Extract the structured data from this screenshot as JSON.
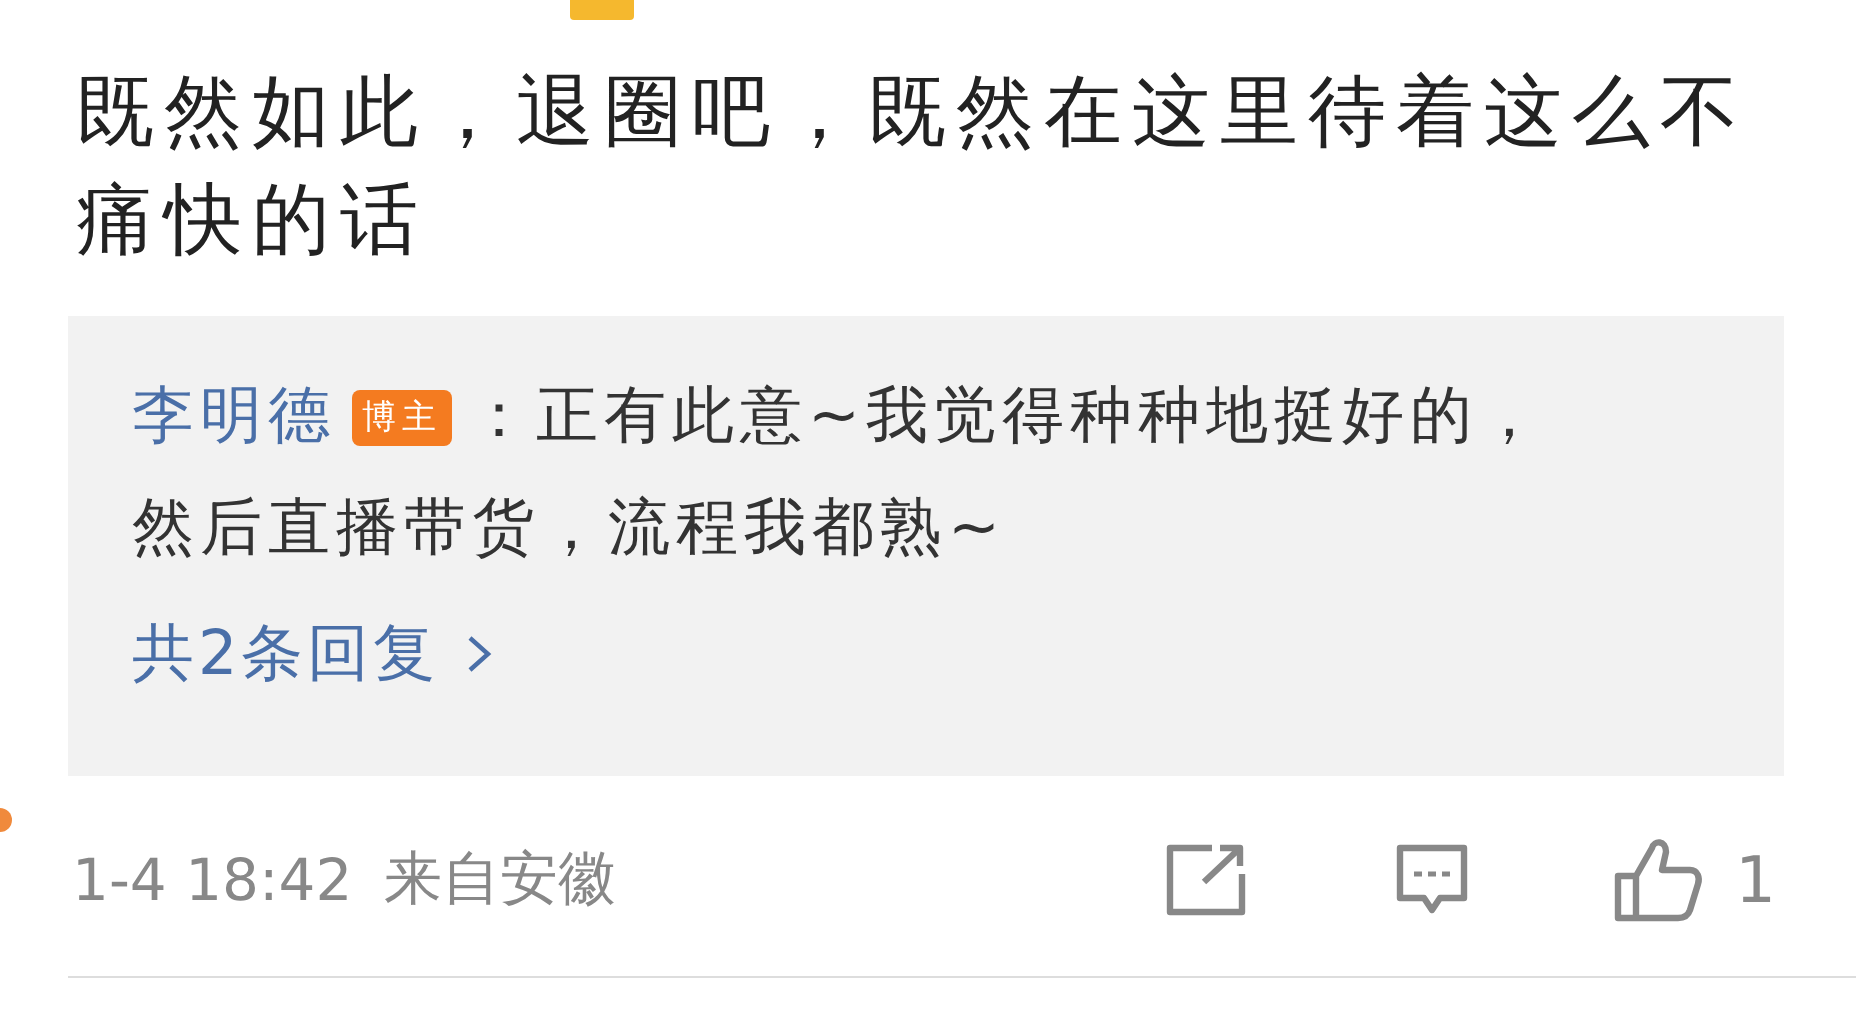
{
  "comment": {
    "text": "既然如此，退圈吧，既然在这里待着这么不痛快的话"
  },
  "reply_box": {
    "reply": {
      "author": "李明德",
      "badge": "博主",
      "text": "：正有此意~我觉得种种地挺好的，然后直播带货，流程我都熟~"
    },
    "more_link": "共2条回复"
  },
  "footer": {
    "time": "1-4 18:42",
    "source": "来自安徽",
    "likes": "1"
  }
}
